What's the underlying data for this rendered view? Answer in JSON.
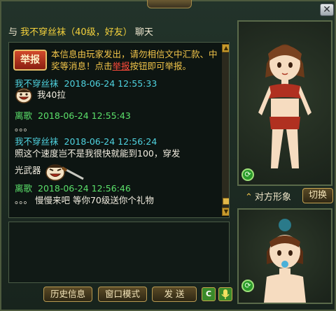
{
  "window": {
    "close_label": "✕"
  },
  "header": {
    "prefix": "与",
    "name": "我不穿丝袜（40级，好友）",
    "suffix": "聊天"
  },
  "warning": {
    "badge": "举报",
    "text_before": "本信息由玩家发出，请勿相信文中汇款、中奖等消息！点击",
    "link": "举报",
    "text_after": "按钮即可举报。"
  },
  "messages": [
    {
      "sender": "我不穿丝袜",
      "time": "2018-06-24 12:55:33",
      "text": "我40拉",
      "side": "them",
      "emoji": "grin-face"
    },
    {
      "sender": "离歌",
      "time": "2018-06-24 12:55:43",
      "text": "。。。",
      "side": "me"
    },
    {
      "sender": "我不穿丝袜",
      "time": "2018-06-24 12:56:24",
      "text": "照这个速度岂不是我很快就能到100，穿发",
      "text2": "光武器",
      "side": "them",
      "emoji": "angry-knife-face"
    },
    {
      "sender": "离歌",
      "time": "2018-06-24 12:56:46",
      "text": "。。。 慢慢来吧 等你70级送你个礼物",
      "side": "me"
    }
  ],
  "buttons": {
    "history": "历史信息",
    "window_mode": "窗口模式",
    "send": "发 送",
    "c_label": "C"
  },
  "side_panel": {
    "target_label": "对方形象",
    "switch_label": "切换"
  },
  "colors": {
    "them_name": "#4fd3e0",
    "me_name": "#5be06a",
    "warning": "#f2c54a",
    "link": "#ff4b3a"
  }
}
